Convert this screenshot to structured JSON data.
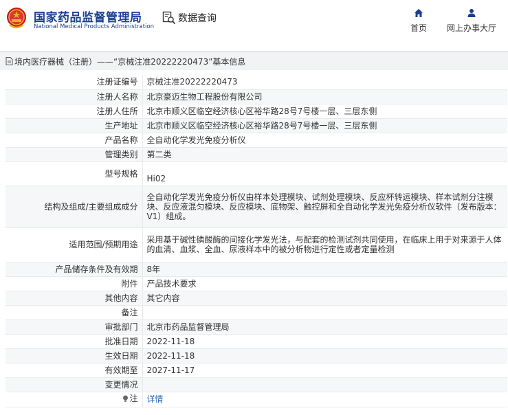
{
  "brand": {
    "name_cn": "国家药品监督管理局",
    "name_en": "National Medical Products Administration"
  },
  "toolbar": {
    "query_label": "数据查询"
  },
  "nav": {
    "home_label": "首页",
    "service_label": "网上办事大厅"
  },
  "page_title": "境内医疗器械（注册）——“京械注准20222220473”基本信息",
  "rows": [
    {
      "label": "注册证编号",
      "value": "京械注准20222220473"
    },
    {
      "label": "注册人名称",
      "value": "北京豪迈生物工程股份有限公司"
    },
    {
      "label": "注册人住所",
      "value": "北京市顺义区临空经济核心区裕华路28号7号楼一层、三层东侧"
    },
    {
      "label": "生产地址",
      "value": "北京市顺义区临空经济核心区裕华路28号7号楼一层、三层东侧"
    },
    {
      "label": "产品名称",
      "value": "全自动化学发光免疫分析仪"
    },
    {
      "label": "管理类别",
      "value": "第二类"
    },
    {
      "label": "型号规格",
      "value": "Hi02"
    },
    {
      "label": "结构及组成/主要组成成分",
      "value": "全自动化学发光免疫分析仪由样本处理模块、试剂处理模块、反应杯转运模块、样本试剂分注模块、反应液混匀模块、反应模块、底物架、触控屏和全自动化学发光免疫分析仪软件（发布版本：V1）组成。"
    },
    {
      "label": "适用范围/预期用途",
      "value": "采用基于碱性磷酸酶的间接化学发光法，与配套的检测试剂共同使用，在临床上用于对来源于人体的血清、血浆、全血、尿液样本中的被分析物进行定性或者定量检测"
    },
    {
      "label": "产品储存条件及有效期",
      "value": "8年"
    },
    {
      "label": "附件",
      "value": "产品技术要求"
    },
    {
      "label": "其他内容",
      "value": "其它内容"
    },
    {
      "label": "备注",
      "value": ""
    },
    {
      "label": "审批部门",
      "value": "北京市药品监督管理局"
    },
    {
      "label": "批准日期",
      "value": "2022-11-18"
    },
    {
      "label": "生效日期",
      "value": "2022-11-18"
    },
    {
      "label": "有效期至",
      "value": "2027-11-17"
    },
    {
      "label": "变更情况",
      "value": ""
    },
    {
      "label": "注",
      "value": "详情"
    }
  ],
  "colors": {
    "brand_blue": "#1b3f8f",
    "link_blue": "#2a6ab8",
    "emblem_red": "#c8161d",
    "emblem_gold": "#e6b422"
  },
  "icons": {
    "emblem": "national-emblem-icon",
    "query": "magnifier-document-icon",
    "home": "home-icon",
    "service": "user-icon",
    "doc": "document-icon",
    "bulb": "lightbulb-icon"
  }
}
